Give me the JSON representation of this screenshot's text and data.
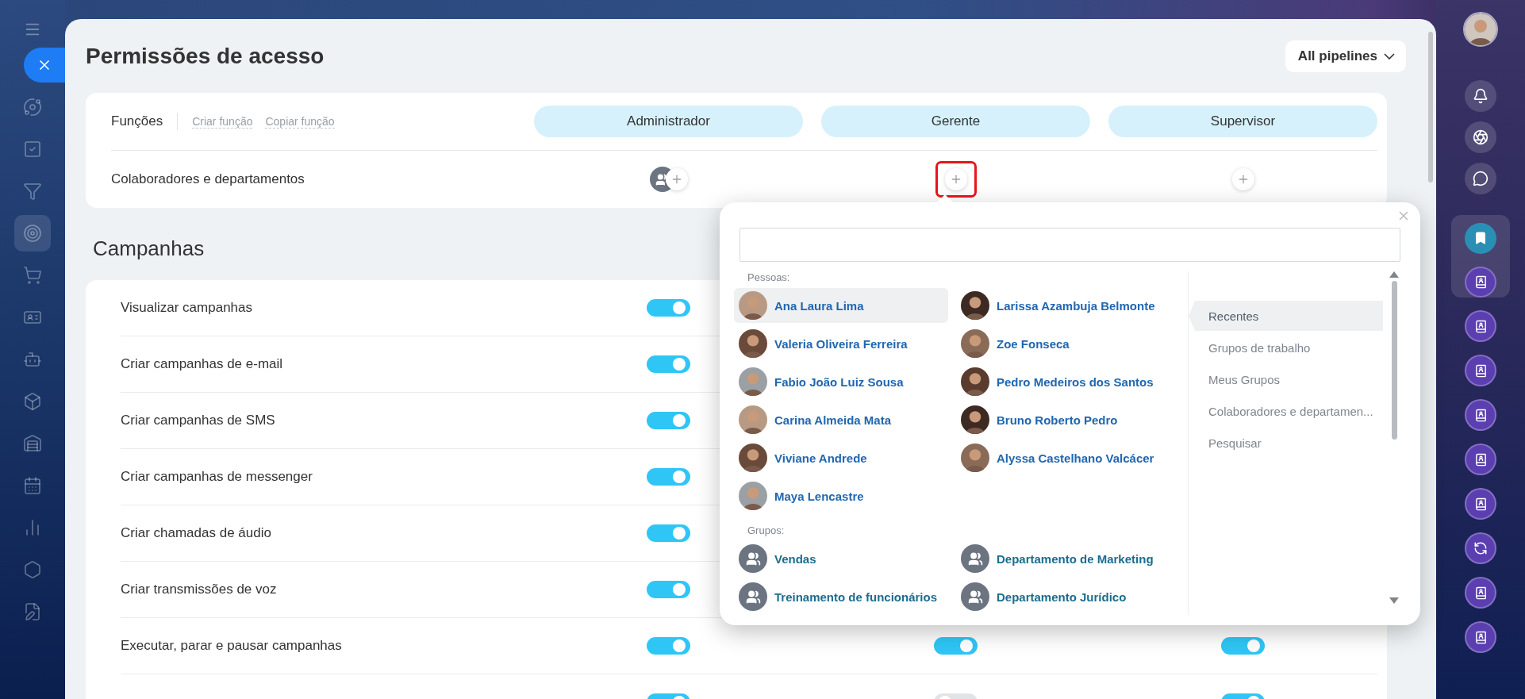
{
  "nav_items": [
    {
      "selected": false
    },
    {
      "selected": false
    },
    {
      "selected": false
    },
    {
      "selected": true
    },
    {
      "selected": false
    },
    {
      "selected": false
    },
    {
      "selected": false
    },
    {
      "selected": false
    },
    {
      "selected": false
    },
    {
      "selected": false
    },
    {
      "selected": false
    },
    {
      "selected": false
    },
    {
      "selected": false
    }
  ],
  "page": {
    "title": "Permissões de acesso",
    "pipeline_select": {
      "value": "All pipelines"
    }
  },
  "roles_card": {
    "label": "Funções",
    "links": [
      "Criar função",
      "Copiar função"
    ],
    "members_label": "Colaboradores e departamentos",
    "roles": [
      {
        "name": "Administrador",
        "has_members": true,
        "highlighted": false
      },
      {
        "name": "Gerente",
        "has_members": false,
        "highlighted": true
      },
      {
        "name": "Supervisor",
        "has_members": false,
        "highlighted": false
      }
    ]
  },
  "section": {
    "title": "Campanhas",
    "rows": [
      {
        "label": "Visualizar campanhas",
        "toggles": [
          {
            "on": true
          }
        ]
      },
      {
        "label": "Criar campanhas de e-mail",
        "toggles": [
          {
            "on": true
          }
        ]
      },
      {
        "label": "Criar campanhas de SMS",
        "toggles": [
          {
            "on": true
          }
        ]
      },
      {
        "label": "Criar campanhas de messenger",
        "toggles": [
          {
            "on": true
          }
        ]
      },
      {
        "label": "Criar chamadas de áudio",
        "toggles": [
          {
            "on": true
          }
        ]
      },
      {
        "label": "Criar transmissões de voz",
        "toggles": [
          {
            "on": true
          }
        ]
      },
      {
        "label": "Executar, parar e pausar campanhas",
        "toggles": [
          {
            "on": true
          },
          {
            "on": true
          },
          {
            "on": true
          }
        ]
      },
      {
        "toggles": [
          {
            "on": true
          },
          {
            "on": false
          },
          {
            "on": true
          }
        ]
      }
    ]
  },
  "picker": {
    "people_label": "Pessoas:",
    "people": [
      {
        "name": "Ana Laura Lima",
        "selected": true
      },
      {
        "name": "Larissa Azambuja Belmonte",
        "selected": false
      },
      {
        "name": "Valeria Oliveira Ferreira",
        "selected": false
      },
      {
        "name": "Zoe Fonseca",
        "selected": false
      },
      {
        "name": "Fabio João Luiz Sousa",
        "selected": false
      },
      {
        "name": "Pedro Medeiros dos Santos",
        "selected": false
      },
      {
        "name": "Carina Almeida Mata",
        "selected": false
      },
      {
        "name": "Bruno Roberto Pedro",
        "selected": false
      },
      {
        "name": "Viviane Andrede",
        "selected": false
      },
      {
        "name": "Alyssa Castelhano Valcácer",
        "selected": false
      },
      {
        "name": "Maya Lencastre",
        "selected": false
      }
    ],
    "groups_label": "Grupos:",
    "groups": [
      {
        "name": "Vendas"
      },
      {
        "name": "Departamento de Marketing"
      },
      {
        "name": "Treinamento de funcionários"
      },
      {
        "name": "Departamento Jurídico"
      }
    ],
    "tabs": [
      {
        "label": "Recentes",
        "selected": true
      },
      {
        "label": "Grupos de trabalho",
        "selected": false
      },
      {
        "label": "Meus Grupos",
        "selected": false
      },
      {
        "label": "Colaboradores e departamen...",
        "selected": false
      },
      {
        "label": "Pesquisar",
        "selected": false
      }
    ]
  }
}
